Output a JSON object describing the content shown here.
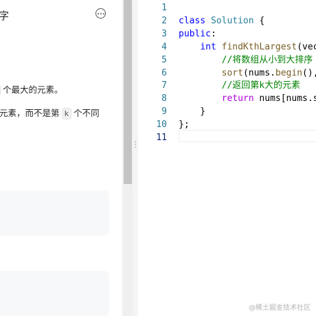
{
  "problem": {
    "title": "字",
    "desc_line1_after_chip": "个最大的元素。",
    "desc_line2_before_chip": "元素，而不是第",
    "desc_line2_chip": "k",
    "desc_line2_after_chip": "个不同"
  },
  "editor": {
    "line_numbers": [
      "1",
      "2",
      "3",
      "4",
      "5",
      "6",
      "7",
      "8",
      "9",
      "10",
      "11"
    ],
    "active_line": "11",
    "lines": [
      [],
      [
        [
          "kw",
          "class"
        ],
        [
          "plain",
          " "
        ],
        [
          "type",
          "Solution"
        ],
        [
          "plain",
          " {"
        ]
      ],
      [
        [
          "kw",
          "public"
        ],
        [
          "plain",
          ":"
        ]
      ],
      [
        [
          "plain",
          "    "
        ],
        [
          "kw",
          "int"
        ],
        [
          "plain",
          " "
        ],
        [
          "fn",
          "findKthLargest"
        ],
        [
          "plain",
          "(vec"
        ]
      ],
      [
        [
          "plain",
          "        "
        ],
        [
          "cm",
          "//将数组从小到大排序"
        ]
      ],
      [
        [
          "plain",
          "        "
        ],
        [
          "fn",
          "sort"
        ],
        [
          "plain",
          "(nums."
        ],
        [
          "fn",
          "begin"
        ],
        [
          "plain",
          "(),"
        ]
      ],
      [
        [
          "plain",
          "        "
        ],
        [
          "cm",
          "//返回第k大的元素"
        ]
      ],
      [
        [
          "plain",
          "        "
        ],
        [
          "ctrl",
          "return"
        ],
        [
          "plain",
          " nums[nums.s"
        ]
      ],
      [
        [
          "plain",
          "    }"
        ]
      ],
      [
        [
          "plain",
          "};"
        ]
      ],
      []
    ]
  },
  "watermark": "@稀土掘金技术社区"
}
